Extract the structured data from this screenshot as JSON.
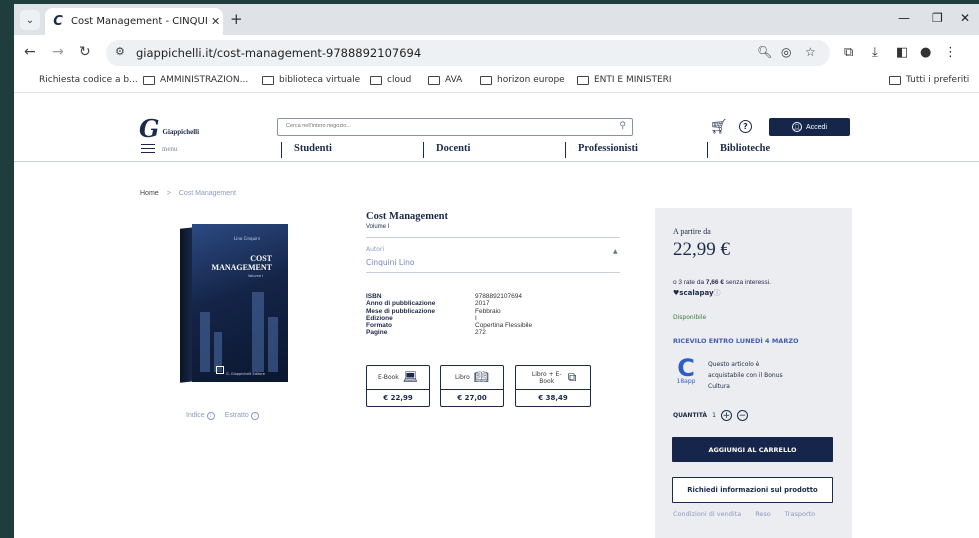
{
  "browser": {
    "tab_title": "Cost Management - CINQUINI",
    "tab_favicon": "C",
    "url": "giappichelli.it/cost-management-9788892107694",
    "bookmarks": [
      {
        "label": "Richiesta codice a b...",
        "folder": false
      },
      {
        "label": "AMMINISTRAZION...",
        "folder": true
      },
      {
        "label": "biblioteca virtuale",
        "folder": true
      },
      {
        "label": "cloud",
        "folder": true
      },
      {
        "label": "AVA",
        "folder": true
      },
      {
        "label": "horizon europe",
        "folder": true
      },
      {
        "label": "ENTI E MINISTERI",
        "folder": true
      }
    ],
    "all_bookmarks_label": "Tutti i preferiti"
  },
  "header": {
    "logo_mark": "G",
    "logo_text": "Giappichelli",
    "menu_label": "menu",
    "search_placeholder": "Cerca nell'intero negozio...",
    "login_label": "Accedi",
    "nav": [
      "Studenti",
      "Docenti",
      "Professionisti",
      "Biblioteche"
    ]
  },
  "breadcrumb": {
    "home": "Home",
    "separator": ">",
    "current": "Cost Management"
  },
  "book_cover": {
    "author": "Lino Cinquini",
    "title_line1": "COST",
    "title_line2": "MANAGEMENT",
    "volume": "Volume I",
    "publisher": "G. Giappichelli Editore"
  },
  "under_cover_links": {
    "index": "Indice",
    "extract": "Estratto"
  },
  "product": {
    "title": "Cost Management",
    "subtitle": "Volume I",
    "authors_label": "Autori",
    "authors_value": "Cinquini Lino",
    "specs": [
      {
        "k": "ISBN",
        "v": "9788892107694"
      },
      {
        "k": "Anno di pubblicazione",
        "v": "2017"
      },
      {
        "k": "Mese di pubblicazione",
        "v": "Febbraio"
      },
      {
        "k": "Edizione",
        "v": "I"
      },
      {
        "k": "Formato",
        "v": "Copertina Flessibile"
      },
      {
        "k": "Pagine",
        "v": "272"
      }
    ],
    "formats": [
      {
        "label": "E-Book",
        "price": "€ 22,99",
        "icon": "laptop-icon"
      },
      {
        "label": "Libro",
        "price": "€ 27,00",
        "icon": "book-icon"
      },
      {
        "label": "Libro + E-Book",
        "price": "€ 38,49",
        "icon": "devices-icon"
      }
    ]
  },
  "buybox": {
    "from_label": "A partire da",
    "price": "22,99 €",
    "rate_prefix": "o 3 rate da ",
    "rate_amount": "7,66 €",
    "rate_suffix": " senza interessi.",
    "scalapay": "scalapay",
    "availability": "Disponibile",
    "delivery": "RICEVILO ENTRO LUNEDÌ 4 MARZO",
    "app_label": "18app",
    "bonus_text": "Questo articolo è acquistabile con il Bonus Cultura",
    "qty_label": "QUANTITÀ",
    "qty_value": "1",
    "add_to_cart": "AGGIUNGI AL CARRELLO",
    "request_info": "Richiedi informazioni sul prodotto",
    "links": [
      "Condizioni di vendita",
      "Reso",
      "Trasporto"
    ]
  },
  "colors": {
    "navy": "#16254a",
    "accent_blue": "#3f5fb0",
    "available_green": "#3b7a3b",
    "box_bg": "#ecedf0"
  }
}
